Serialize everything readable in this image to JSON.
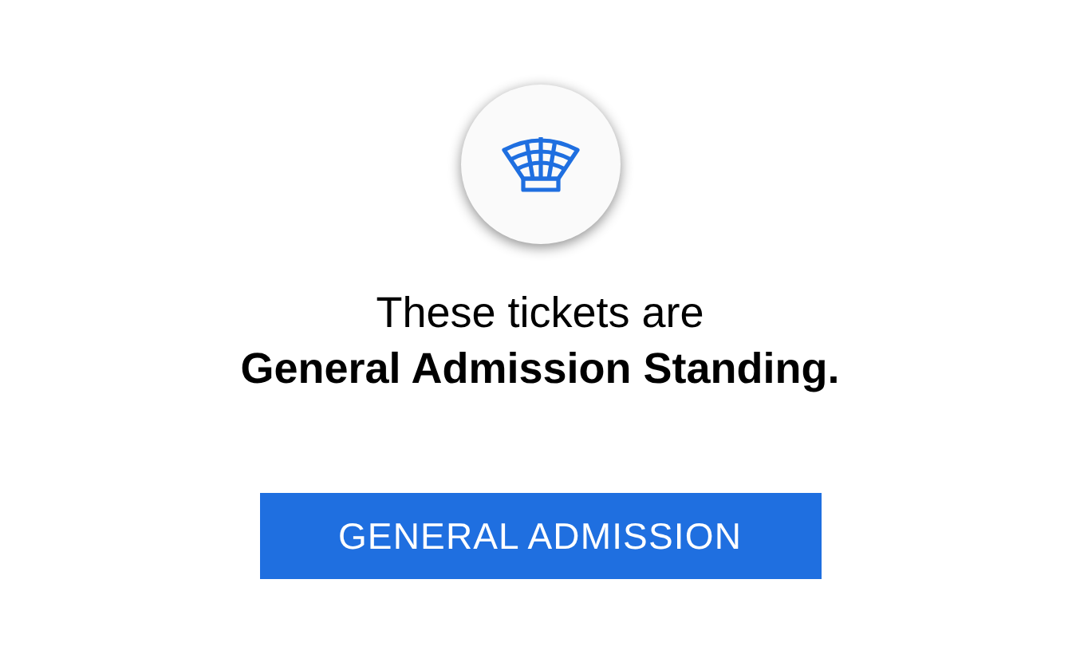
{
  "message": {
    "line_1": "These tickets are",
    "line_2": "General Admission Standing."
  },
  "button": {
    "label": "GENERAL ADMISSION"
  }
}
